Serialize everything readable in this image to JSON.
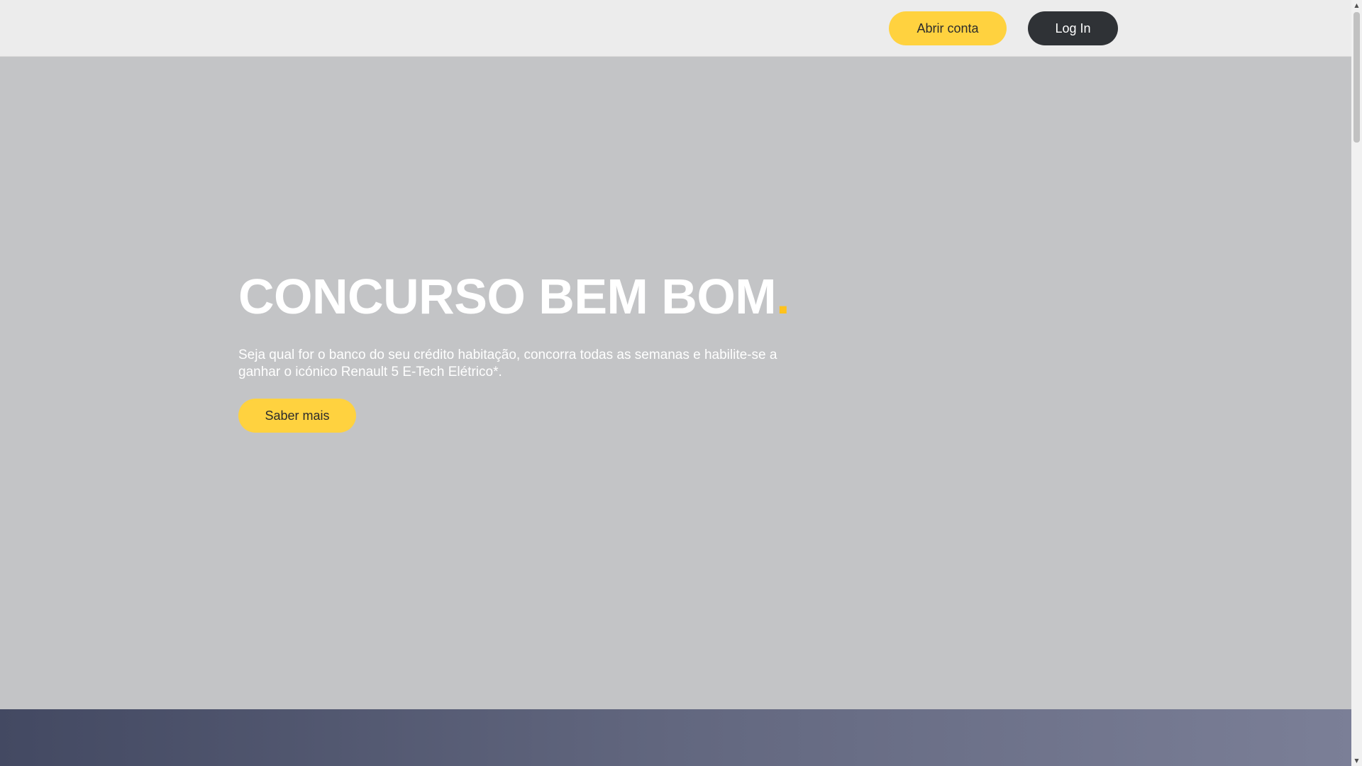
{
  "header": {
    "open_account_label": "Abrir conta",
    "login_label": "Log In"
  },
  "hero": {
    "title": "CONCURSO BEM BOM",
    "title_dot": ".",
    "text": "Seja qual for o banco do seu crédito habitação, concorra todas as semanas e habilite-se a ganhar o icónico Renault 5 E-Tech Elétrico*.",
    "cta_label": "Saber mais"
  },
  "scrollbar": {
    "up_icon": "▲",
    "down_icon": "▼"
  },
  "colors": {
    "accent_yellow": "#ffd23f",
    "dot_yellow": "#ffc21c",
    "dark_button": "#2f3236",
    "hero_bg": "#c3c4c6",
    "header_bg": "#ececec"
  }
}
